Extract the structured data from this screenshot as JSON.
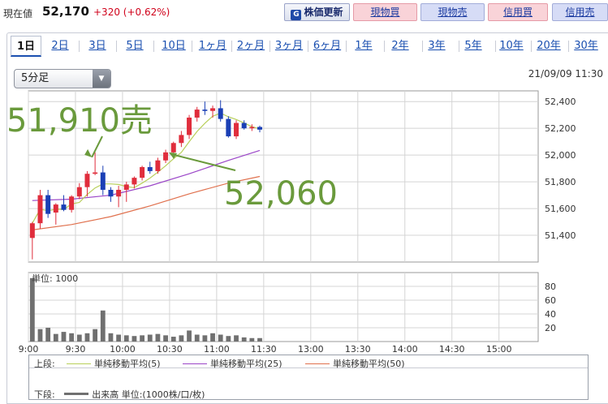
{
  "header": {
    "price_label": "現在値",
    "price": "52,170",
    "change": "+320 (+0.62%)",
    "refresh_label": "株価更新",
    "buttons": [
      "現物買",
      "現物売",
      "信用買",
      "信用売"
    ]
  },
  "tabs": [
    "1日",
    "2日",
    "3日",
    "5日",
    "10日",
    "1ヶ月",
    "2ヶ月",
    "3ヶ月",
    "6ヶ月",
    "1年",
    "2年",
    "3年",
    "5年",
    "10年",
    "20年",
    "30年"
  ],
  "active_tab": "1日",
  "interval_select": "5分足",
  "datetime": "21/09/09 11:30",
  "colors": {
    "up": "#e02d3c",
    "down": "#1a3fb5",
    "ma5": "#b8cf5a",
    "ma25": "#9b46c8",
    "ma50": "#e0704d",
    "volume": "#707070",
    "annotation": "#6a9a3c"
  },
  "chart_data": {
    "type": "candlestick",
    "x_ticks": [
      "9:00",
      "9:30",
      "10:00",
      "10:30",
      "11:00",
      "11:30",
      "13:00",
      "13:30",
      "14:00",
      "14:30",
      "15:00"
    ],
    "x_session": {
      "start": "9:00",
      "end": "15:25",
      "break_start": "11:30",
      "break_end": "12:30"
    },
    "candle_interval_minutes": 5,
    "price_axis": {
      "ticks": [
        "52,400",
        "52,200",
        "52,000",
        "51,800",
        "51,600",
        "51,400"
      ],
      "range": [
        51200,
        52480
      ]
    },
    "volume_axis": {
      "ticks": [
        "80",
        "60",
        "40",
        "20"
      ],
      "range": [
        0,
        100
      ],
      "unit_label": "単位: 1000"
    },
    "candles": [
      {
        "t": "9:00",
        "o": 51380,
        "h": 51500,
        "l": 51220,
        "c": 51490
      },
      {
        "t": "9:05",
        "o": 51490,
        "h": 51740,
        "l": 51450,
        "c": 51700
      },
      {
        "t": "9:10",
        "o": 51700,
        "h": 51740,
        "l": 51530,
        "c": 51560
      },
      {
        "t": "9:15",
        "o": 51570,
        "h": 51640,
        "l": 51480,
        "c": 51630
      },
      {
        "t": "9:20",
        "o": 51630,
        "h": 51700,
        "l": 51580,
        "c": 51590
      },
      {
        "t": "9:25",
        "o": 51590,
        "h": 51700,
        "l": 51570,
        "c": 51690
      },
      {
        "t": "9:30",
        "o": 51690,
        "h": 51790,
        "l": 51670,
        "c": 51760
      },
      {
        "t": "9:35",
        "o": 51760,
        "h": 51880,
        "l": 51690,
        "c": 51860
      },
      {
        "t": "9:40",
        "o": 51860,
        "h": 52020,
        "l": 51850,
        "c": 51870
      },
      {
        "t": "9:45",
        "o": 51870,
        "h": 51920,
        "l": 51700,
        "c": 51740
      },
      {
        "t": "9:50",
        "o": 51740,
        "h": 51760,
        "l": 51650,
        "c": 51690
      },
      {
        "t": "9:55",
        "o": 51690,
        "h": 51770,
        "l": 51610,
        "c": 51740
      },
      {
        "t": "10:00",
        "o": 51740,
        "h": 51800,
        "l": 51650,
        "c": 51780
      },
      {
        "t": "10:05",
        "o": 51780,
        "h": 51840,
        "l": 51750,
        "c": 51830
      },
      {
        "t": "10:10",
        "o": 51830,
        "h": 51920,
        "l": 51810,
        "c": 51910
      },
      {
        "t": "10:15",
        "o": 51910,
        "h": 51950,
        "l": 51860,
        "c": 51880
      },
      {
        "t": "10:20",
        "o": 51880,
        "h": 51980,
        "l": 51860,
        "c": 51960
      },
      {
        "t": "10:25",
        "o": 51960,
        "h": 52040,
        "l": 51940,
        "c": 52020
      },
      {
        "t": "10:30",
        "o": 52020,
        "h": 52100,
        "l": 51990,
        "c": 52090
      },
      {
        "t": "10:35",
        "o": 52090,
        "h": 52180,
        "l": 52060,
        "c": 52150
      },
      {
        "t": "10:40",
        "o": 52150,
        "h": 52300,
        "l": 52120,
        "c": 52280
      },
      {
        "t": "10:45",
        "o": 52280,
        "h": 52360,
        "l": 52250,
        "c": 52340
      },
      {
        "t": "10:50",
        "o": 52340,
        "h": 52400,
        "l": 52300,
        "c": 52330
      },
      {
        "t": "10:55",
        "o": 52330,
        "h": 52370,
        "l": 52280,
        "c": 52350
      },
      {
        "t": "11:00",
        "o": 52350,
        "h": 52410,
        "l": 52250,
        "c": 52270
      },
      {
        "t": "11:05",
        "o": 52270,
        "h": 52290,
        "l": 52130,
        "c": 52140
      },
      {
        "t": "11:10",
        "o": 52140,
        "h": 52260,
        "l": 52120,
        "c": 52240
      },
      {
        "t": "11:15",
        "o": 52240,
        "h": 52260,
        "l": 52190,
        "c": 52200
      },
      {
        "t": "11:20",
        "o": 52200,
        "h": 52230,
        "l": 52180,
        "c": 52210
      },
      {
        "t": "11:25",
        "o": 52210,
        "h": 52220,
        "l": 52170,
        "c": 52190
      }
    ],
    "volume": [
      92,
      18,
      20,
      11,
      14,
      12,
      10,
      12,
      18,
      45,
      12,
      10,
      9,
      8,
      9,
      10,
      11,
      9,
      7,
      9,
      16,
      10,
      9,
      12,
      10,
      8,
      9,
      6,
      5,
      5
    ],
    "moving_averages": [
      {
        "label": "単純移動平均(5)",
        "period": 5,
        "color": "#b8cf5a"
      },
      {
        "label": "単純移動平均(25)",
        "period": 25,
        "color": "#9b46c8"
      },
      {
        "label": "単純移動平均(50)",
        "period": 50,
        "color": "#e0704d"
      }
    ],
    "ma25": [
      [
        0,
        51660
      ],
      [
        5,
        51670
      ],
      [
        10,
        51700
      ],
      [
        15,
        51770
      ],
      [
        20,
        51860
      ],
      [
        25,
        51960
      ],
      [
        29,
        52035
      ]
    ],
    "ma50": [
      [
        0,
        51440
      ],
      [
        5,
        51480
      ],
      [
        10,
        51540
      ],
      [
        15,
        51620
      ],
      [
        20,
        51710
      ],
      [
        25,
        51790
      ],
      [
        29,
        51840
      ]
    ],
    "annotations": [
      {
        "text": "51,910売",
        "target_index": 8
      },
      {
        "text": "52,060",
        "target_index": 17
      }
    ]
  },
  "legend": {
    "upper_label": "上段:",
    "lower_label": "下段:",
    "volume_label": "出来高 単位:(1000株/口/枚)"
  }
}
